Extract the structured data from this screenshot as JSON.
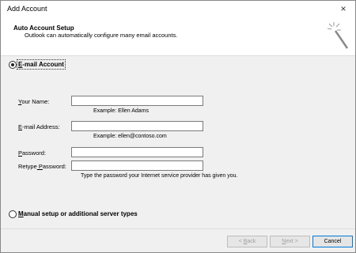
{
  "window": {
    "title": "Add Account",
    "close": "×"
  },
  "header": {
    "title": "Auto Account Setup",
    "subtitle": "Outlook can automatically configure many email accounts."
  },
  "options": {
    "email_account": {
      "ul": "E",
      "rest": "-mail Account",
      "selected": true
    },
    "manual": {
      "ul": "M",
      "rest": "anual setup or additional server types",
      "selected": false
    }
  },
  "form": {
    "name": {
      "ul": "Y",
      "rest": "our Name:",
      "value": "",
      "hint": "Example: Ellen Adams"
    },
    "email": {
      "ul": "E",
      "rest": "-mail Address:",
      "value": "",
      "hint": "Example: ellen@contoso.com"
    },
    "password": {
      "ul": "P",
      "rest": "assword:",
      "value": ""
    },
    "retype": {
      "pre": "Retype",
      "ul": " P",
      "rest": "assword:",
      "value": "",
      "hint": "Type the password your Internet service provider has given you."
    }
  },
  "footer": {
    "back": {
      "pre": "< ",
      "ul": "B",
      "rest": "ack",
      "enabled": false
    },
    "next": {
      "ul": "N",
      "rest": "ext >",
      "enabled": false
    },
    "cancel": {
      "label": "Cancel",
      "enabled": true
    }
  }
}
